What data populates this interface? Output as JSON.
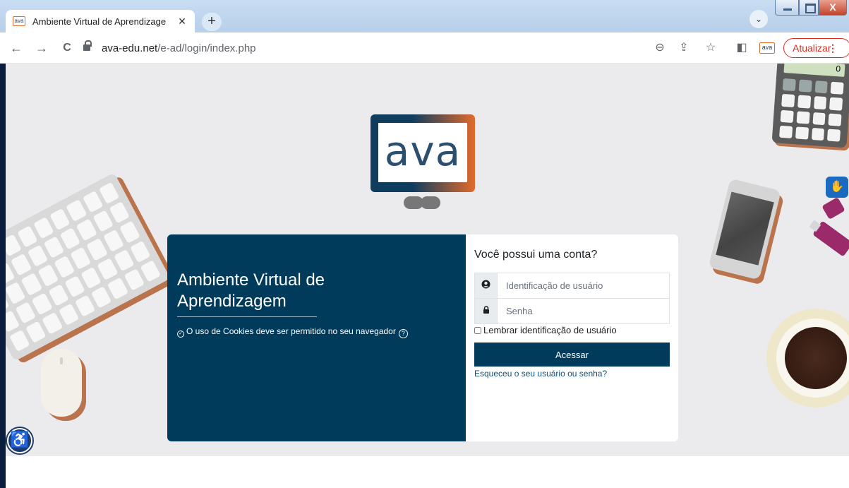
{
  "browser": {
    "tab_title": "Ambiente Virtual de Aprendizage",
    "tab_close": "✕",
    "new_tab": "+",
    "tab_search": "⌄",
    "favicon_text": "ava",
    "url_host": "ava-edu.net",
    "url_path": "/e-ad/login/index.php",
    "update_label": "Atualizar",
    "update_menu": "⋮",
    "nav_back": "←",
    "nav_forward": "→",
    "nav_reload": "C",
    "icons": [
      "zoom-icon",
      "share-icon",
      "bookmark-star-icon",
      "side-panel-icon",
      "ava-extension-icon"
    ],
    "zoom_glyph": "⊖",
    "share_glyph": "⇪",
    "star_glyph": "☆",
    "panel_glyph": "◧",
    "window_close_glyph": "X"
  },
  "logo": {
    "text": "ava",
    "colors": [
      "#0f3d5e",
      "#e26b2b"
    ]
  },
  "login": {
    "hero_title": "Ambiente Virtual de Aprendizagem",
    "cookie_notice": "O uso de Cookies deve ser permitido no seu navegador",
    "cookie_icon": "✓",
    "help_icon": "?",
    "heading": "Você possui uma conta?",
    "username_placeholder": "Identificação de usuário",
    "password_placeholder": "Senha",
    "remember_label": "Lembrar identificação de usuário",
    "submit_label": "Acessar",
    "forgot_link": "Esqueceu o seu usuário ou senha?",
    "accent_color": "#003b5c"
  },
  "decor": {
    "calculator_display": "0",
    "hand_glyph": "✋",
    "accessibility_glyph": "♿"
  }
}
